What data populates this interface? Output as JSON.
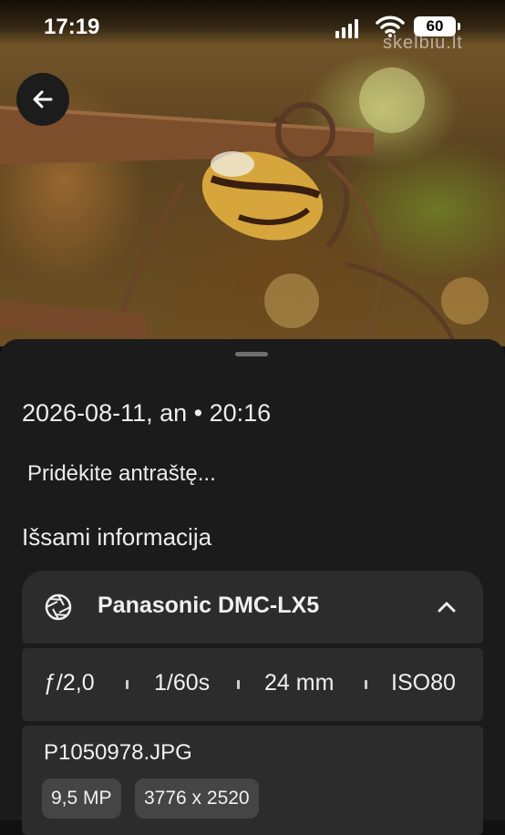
{
  "status_bar": {
    "time": "17:19",
    "battery": "60",
    "watermark": "skelbiu.lt"
  },
  "photo": {
    "subject": "snail on rusty wire fence",
    "colors": {
      "fence": "#7a4a2a",
      "shell": "#d4a53a",
      "stripe": "#3a1e10"
    }
  },
  "sheet": {
    "datetime": "2026-08-11, an  •  20:16",
    "caption_placeholder": "Pridėkite antraštę...",
    "section_title": "Išsami informacija",
    "camera": {
      "name": "Panasonic DMC-LX5",
      "icon": "aperture-icon",
      "expand_icon": "chevron-up-icon"
    },
    "settings": {
      "aperture": "ƒ/2,0",
      "shutter": "1/60s",
      "focal_length": "24 mm",
      "iso": "ISO80"
    },
    "file": {
      "name": "P1050978.JPG",
      "megapixels": "9,5 MP",
      "resolution": "3776 x 2520"
    }
  },
  "colors": {
    "sheet_bg": "#1b1b1b",
    "card_bg": "#2c2c2c",
    "chip_bg": "#454545"
  }
}
